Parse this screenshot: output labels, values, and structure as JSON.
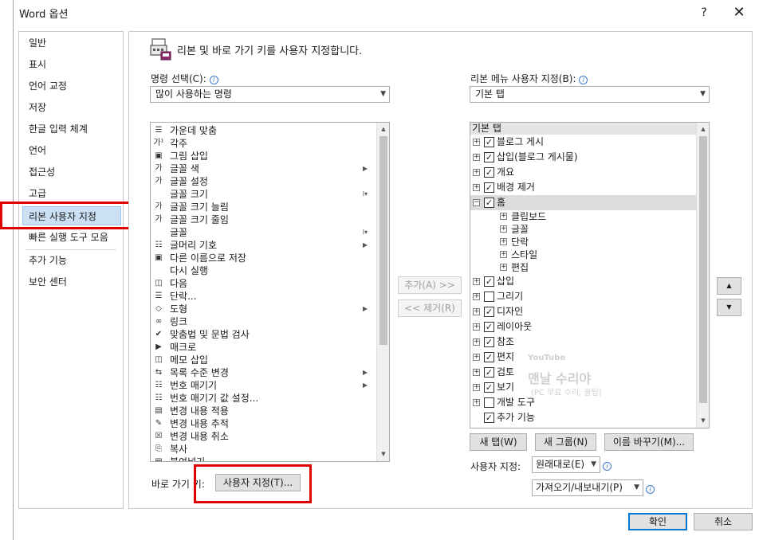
{
  "window": {
    "title": "Word 옵션",
    "help": "?",
    "close": "✕"
  },
  "nav": {
    "items": [
      "일반",
      "표시",
      "언어 교정",
      "저장",
      "한글 입력 체계",
      "언어",
      "접근성",
      "고급",
      "리본 사용자 지정",
      "빠른 실행 도구 모음",
      "추가 기능",
      "보안 센터"
    ],
    "selected": "리본 사용자 지정"
  },
  "header": {
    "text": "리본 및 바로 가기 키를 사용자 지정합니다."
  },
  "commands": {
    "label": "명령 선택(C):",
    "dropdown_value": "많이 사용하는 명령",
    "items": [
      {
        "label": "가운데 맞춤",
        "icon": "align-center-icon",
        "glyph": "☰",
        "right": ""
      },
      {
        "label": "각주",
        "icon": "footnote-icon",
        "glyph": "가¹",
        "right": ""
      },
      {
        "label": "그림 삽입",
        "icon": "picture-icon",
        "glyph": "▣",
        "right": ""
      },
      {
        "label": "글꼴 색",
        "icon": "font-color-icon",
        "glyph": "가",
        "right": "▶"
      },
      {
        "label": "글꼴 설정",
        "icon": "font-settings-icon",
        "glyph": "가",
        "right": ""
      },
      {
        "label": "글꼴 크기",
        "icon": "font-size-icon",
        "glyph": "",
        "right": "I▾"
      },
      {
        "label": "글꼴 크기 늘림",
        "icon": "grow-font-icon",
        "glyph": "가",
        "right": ""
      },
      {
        "label": "글꼴 크기 줄임",
        "icon": "shrink-font-icon",
        "glyph": "가",
        "right": ""
      },
      {
        "label": "글꼴",
        "icon": "font-icon",
        "glyph": "",
        "right": "I▾"
      },
      {
        "label": "글머리 기호",
        "icon": "bullets-icon",
        "glyph": "☷",
        "right": "▶"
      },
      {
        "label": "다른 이름으로 저장",
        "icon": "save-as-icon",
        "glyph": "▣",
        "right": ""
      },
      {
        "label": "다시 실행",
        "icon": "redo-icon",
        "glyph": "",
        "right": ""
      },
      {
        "label": "다음",
        "icon": "next-comment-icon",
        "glyph": "◫",
        "right": ""
      },
      {
        "label": "단락...",
        "icon": "paragraph-icon",
        "glyph": "☰",
        "right": ""
      },
      {
        "label": "도형",
        "icon": "shapes-icon",
        "glyph": "◇",
        "right": "▶"
      },
      {
        "label": "링크",
        "icon": "link-icon",
        "glyph": "∞",
        "right": ""
      },
      {
        "label": "맞춤법 및 문법 검사",
        "icon": "spelling-icon",
        "glyph": "✔",
        "right": ""
      },
      {
        "label": "매크로",
        "icon": "macro-icon",
        "glyph": "▶",
        "right": ""
      },
      {
        "label": "메모 삽입",
        "icon": "comment-icon",
        "glyph": "◫",
        "right": ""
      },
      {
        "label": "목록 수준 변경",
        "icon": "list-level-icon",
        "glyph": "⇆",
        "right": "▶"
      },
      {
        "label": "번호 매기기",
        "icon": "numbering-icon",
        "glyph": "☷",
        "right": "▶"
      },
      {
        "label": "번호 매기기 값 설정...",
        "icon": "numbering-value-icon",
        "glyph": "☷",
        "right": ""
      },
      {
        "label": "변경 내용 적용",
        "icon": "accept-change-icon",
        "glyph": "▤",
        "right": ""
      },
      {
        "label": "변경 내용 추적",
        "icon": "track-changes-icon",
        "glyph": "✎",
        "right": ""
      },
      {
        "label": "변경 내용 취소",
        "icon": "reject-change-icon",
        "glyph": "☒",
        "right": ""
      },
      {
        "label": "복사",
        "icon": "copy-icon",
        "glyph": "⎘",
        "right": ""
      },
      {
        "label": "붙여넣기",
        "icon": "paste-icon",
        "glyph": "▤",
        "right": ""
      }
    ]
  },
  "middle": {
    "add": "추가(A) >>",
    "remove": "<< 제거(R)"
  },
  "ribbon": {
    "label": "리본 메뉴 사용자 지정(B):",
    "dropdown_value": "기본 탭",
    "tree_header": "기본 탭",
    "tabs": [
      {
        "label": "블로그 게시",
        "checked": true,
        "expanded": false,
        "level": 0
      },
      {
        "label": "삽입(블로그 게시물)",
        "checked": true,
        "expanded": false,
        "level": 0
      },
      {
        "label": "개요",
        "checked": true,
        "expanded": false,
        "level": 0
      },
      {
        "label": "배경 제거",
        "checked": true,
        "expanded": false,
        "level": 0
      },
      {
        "label": "홈",
        "checked": true,
        "expanded": true,
        "level": 0,
        "selected": true
      },
      {
        "label": "클립보드",
        "level": 1
      },
      {
        "label": "글꼴",
        "level": 1
      },
      {
        "label": "단락",
        "level": 1
      },
      {
        "label": "스타일",
        "level": 1
      },
      {
        "label": "편집",
        "level": 1
      },
      {
        "label": "삽입",
        "checked": true,
        "expanded": false,
        "level": 0
      },
      {
        "label": "그리기",
        "checked": false,
        "expanded": false,
        "level": 0
      },
      {
        "label": "디자인",
        "checked": true,
        "expanded": false,
        "level": 0
      },
      {
        "label": "레이아웃",
        "checked": true,
        "expanded": false,
        "level": 0
      },
      {
        "label": "참조",
        "checked": true,
        "expanded": false,
        "level": 0
      },
      {
        "label": "편지",
        "checked": true,
        "expanded": false,
        "level": 0
      },
      {
        "label": "검토",
        "checked": true,
        "expanded": false,
        "level": 0
      },
      {
        "label": "보기",
        "checked": true,
        "expanded": false,
        "level": 0
      },
      {
        "label": "개발 도구",
        "checked": false,
        "expanded": false,
        "level": 0
      },
      {
        "label": "추가 기능",
        "checked": true,
        "expanded": null,
        "level": 0
      }
    ],
    "new_tab": "새 탭(W)",
    "new_group": "새 그룹(N)",
    "rename": "이름 바꾸기(M)...",
    "custom_label": "사용자 지정:",
    "reset": "원래대로(E)",
    "import_export": "가져오기/내보내기(P)",
    "move_up": "▲",
    "move_down": "▼"
  },
  "shortcut": {
    "label": "바로 가기 키:",
    "button": "사용자 지정(T)..."
  },
  "footer": {
    "ok": "확인",
    "cancel": "취소"
  },
  "watermark": {
    "badge": "YouTube",
    "name": "맨날 수리야",
    "sub": "(PC 무료 수리, 꿀팁)"
  },
  "colors": {
    "accent": "#0078d7",
    "selection": "#cce0f5",
    "highlight_box": "#e00000"
  }
}
